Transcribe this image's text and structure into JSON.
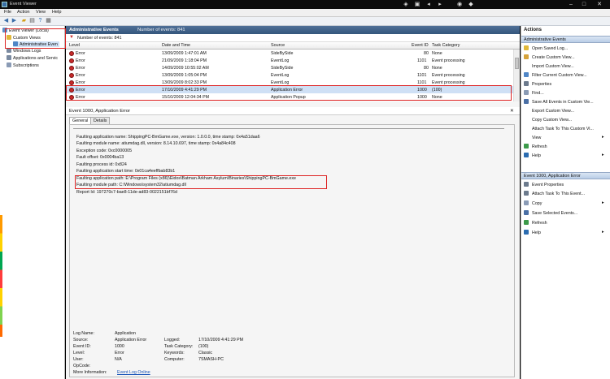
{
  "window": {
    "title": "Event Viewer"
  },
  "menu": [
    "File",
    "Action",
    "View",
    "Help"
  ],
  "tree": {
    "root": "Event Viewer (Local)",
    "custom_views": "Custom Views",
    "admin_events": "Administrative Even",
    "windows_logs": "Windows Logs",
    "apps_services": "Applications and Servic",
    "subscriptions": "Subscriptions"
  },
  "list": {
    "header": "Administrative Events",
    "header_count": "Number of events: 841",
    "count_label": "Number of events: 841",
    "columns": {
      "level": "Level",
      "datetime": "Date and Time",
      "source": "Source",
      "event_id": "Event ID",
      "task": "Task Category"
    },
    "rows": [
      {
        "level": "Error",
        "datetime": "13/09/2009 1:47:01 AM",
        "source": "SideBySide",
        "event_id": "80",
        "task": "None"
      },
      {
        "level": "Error",
        "datetime": "21/09/2009 1:18:04 PM",
        "source": "EventLog",
        "event_id": "1101",
        "task": "Event processing"
      },
      {
        "level": "Error",
        "datetime": "14/09/2009 10:55:02 AM",
        "source": "SideBySide",
        "event_id": "80",
        "task": "None"
      },
      {
        "level": "Error",
        "datetime": "13/09/2009 1:05:04 PM",
        "source": "EventLog",
        "event_id": "1101",
        "task": "Event processing"
      },
      {
        "level": "Error",
        "datetime": "13/09/2009 8:02:33 PM",
        "source": "EventLog",
        "event_id": "1101",
        "task": "Event processing"
      },
      {
        "level": "Error",
        "datetime": "17/10/2009 4:41:29 PM",
        "source": "Application Error",
        "event_id": "1000",
        "task": "(100)"
      },
      {
        "level": "Error",
        "datetime": "15/10/2009 12:04:34 PM",
        "source": "Application Popup",
        "event_id": "1000",
        "task": "None"
      }
    ]
  },
  "detail": {
    "header": "Event 1000, Application Error",
    "tabs": [
      "General",
      "Details"
    ],
    "message": [
      "Faulting application name: ShippingPC-BmGame.exe, version: 1.0.0.0, time stamp: 0x4a51daa6",
      "Faulting module name: atiumdag.dll, version: 8.14.10.697, time stamp: 0x4a84c408",
      "Exception code: 0xc0000005",
      "Fault offset: 0x0004ba13",
      "Faulting process id: 0x824",
      "Faulting application start time: 0x01ca4eeffbab83b1",
      "Faulting application path: E:\\Program Files (x86)\\Eidos\\Batman Arkham Asylum\\Binaries\\ShippingPC-BmGame.exe",
      "Faulting module path: C:\\Windows\\system32\\atiumdag.dll",
      "Report Id: 197270c7-bae8-11de-ad83-0022151bf76d"
    ],
    "fields": {
      "log_name_label": "Log Name:",
      "log_name": "Application",
      "source_label": "Source:",
      "source": "Application Error",
      "logged_label": "Logged:",
      "logged": "17/10/2009 4:41:29 PM",
      "event_id_label": "Event ID:",
      "event_id": "1000",
      "task_label": "Task Category:",
      "task": "(100)",
      "level_label": "Level:",
      "level": "Error",
      "keywords_label": "Keywords:",
      "keywords": "Classic",
      "user_label": "User:",
      "user": "N/A",
      "computer_label": "Computer:",
      "computer": "7SMASH-PC",
      "opcode_label": "OpCode:",
      "more_info_label": "More Information:",
      "more_info_link": "Event Log Online"
    }
  },
  "actions": {
    "title": "Actions",
    "section1": "Administrative Events",
    "items1": [
      "Open Saved Log...",
      "Create Custom View...",
      "Import Custom View...",
      "Filter Current Custom View...",
      "Properties",
      "Find...",
      "Save All Events in Custom Vie...",
      "Export Custom View...",
      "Copy Custom View...",
      "Attach Task To This Custom Vi...",
      "View",
      "Refresh",
      "Help"
    ],
    "section2": "Event 1000, Application Error",
    "items2": [
      "Event Properties",
      "Attach Task To This Event...",
      "Copy",
      "Save Selected Events...",
      "Refresh",
      "Help"
    ]
  }
}
